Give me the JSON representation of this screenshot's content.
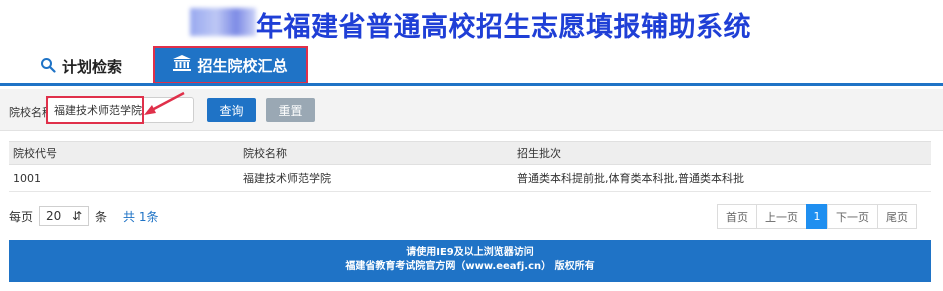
{
  "header": {
    "title_visible": "年福建省普通高校招生志愿填报辅助系统"
  },
  "tabs": [
    {
      "label": "计划检索",
      "icon": "search-icon"
    },
    {
      "label": "招生院校汇总",
      "icon": "institution-icon",
      "active": true
    }
  ],
  "filter": {
    "label": "院校名称",
    "input_value": "福建技术师范学院",
    "query_label": "查询",
    "reset_label": "重置"
  },
  "table": {
    "headers": [
      "院校代号",
      "院校名称",
      "招生批次"
    ],
    "rows": [
      [
        "1001",
        "福建技术师范学院",
        "普通类本科提前批,体育类本科批,普通类本科批"
      ]
    ]
  },
  "pagination": {
    "per_page_label": "每页",
    "per_page_value": "20",
    "unit_label": "条",
    "total_label": "共 1条",
    "first": "首页",
    "prev": "上一页",
    "current": "1",
    "next": "下一页",
    "last": "尾页"
  },
  "footer": {
    "line1": "请使用IE9及以上浏览器访问",
    "line2": "福建省教育考试院官方网（www.eeafj.cn）  版权所有"
  },
  "colors": {
    "primary": "#1f73c6",
    "title": "#1f3fd6",
    "highlight": "#e0304a",
    "reset": "#9aa8b4"
  }
}
